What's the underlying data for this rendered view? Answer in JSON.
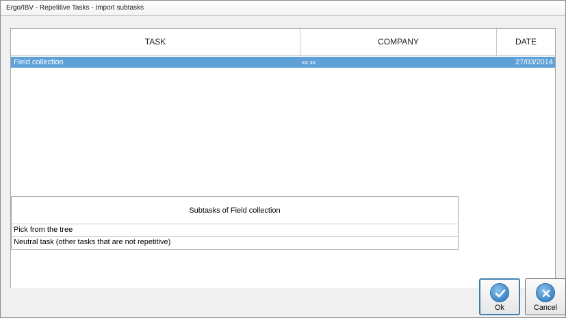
{
  "window": {
    "title": "Ergo/IBV - Repetitive Tasks - Import subtasks"
  },
  "task_table": {
    "columns": [
      "TASK",
      "COMPANY",
      "DATE"
    ],
    "rows": [
      {
        "task": "Field collection",
        "company": "xx xx",
        "date": "27/03/2014",
        "selected": true
      }
    ]
  },
  "subtasks": {
    "header": "Subtasks of Field collection",
    "items": [
      "Pick from the tree",
      "Neutral task (other tasks that are not repetitive)"
    ]
  },
  "buttons": {
    "ok": {
      "label": "Ok",
      "icon": "checkmark-icon"
    },
    "cancel": {
      "label": "Cancel",
      "icon": "close-icon"
    }
  },
  "colors": {
    "selection": "#5ea0d8",
    "button_icon": "#3d86c9"
  }
}
